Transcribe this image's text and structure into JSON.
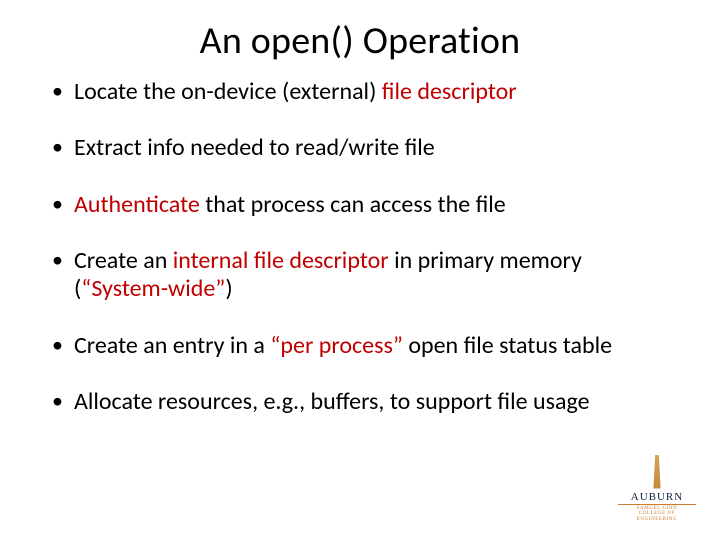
{
  "title": "An open() Operation",
  "bullets": {
    "b1a": "Locate the on-device (external) ",
    "b1b": "file descriptor",
    "b2": "Extract info needed to read/write file",
    "b3a": "Authenticate",
    "b3b": " that process can access the file",
    "b4a": "Create an ",
    "b4b": "internal file descriptor",
    "b4c": " in primary memory (",
    "b4d": "“System-wide”",
    "b4e": ")",
    "b5a": "Create an entry in a ",
    "b5b": "“per process”",
    "b5c": " open file status table",
    "b6": "Allocate resources, e.g., buffers, to support file usage"
  },
  "logo": {
    "name": "AUBURN",
    "sub1": "SAMUEL GINN",
    "sub2": "COLLEGE OF ENGINEERING"
  }
}
